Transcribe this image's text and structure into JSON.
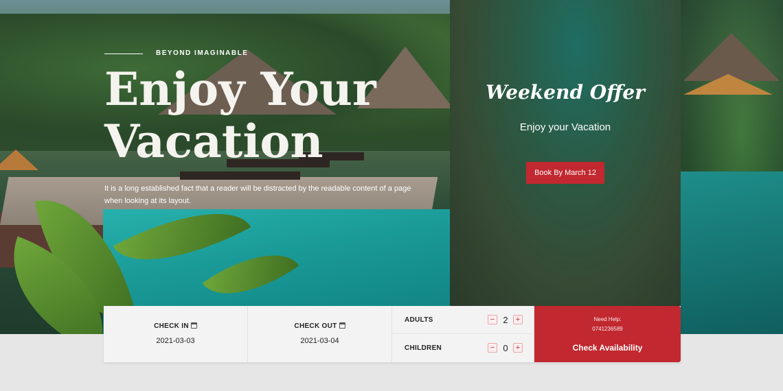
{
  "hero": {
    "eyebrow": "BEYOND IMAGINABLE",
    "title_line1": "Enjoy Your",
    "title_line2": "Vacation",
    "description": "It is a long established fact that a reader will be distracted by the readable content of a page when looking at its layout."
  },
  "offer": {
    "title": "Weekend Offer",
    "subtitle": "Enjoy your Vacation",
    "button_label": "Book By March 12"
  },
  "booking": {
    "check_in": {
      "label": "CHECK IN",
      "value": "2021-03-03",
      "icon": "calendar-icon"
    },
    "check_out": {
      "label": "CHECK OUT",
      "value": "2021-03-04",
      "icon": "calendar-icon"
    },
    "adults": {
      "label": "ADULTS",
      "value": "2",
      "minus": "−",
      "plus": "+"
    },
    "children": {
      "label": "CHILDREN",
      "value": "0",
      "minus": "−",
      "plus": "+"
    },
    "help_label": "Need Help:",
    "help_phone": "0741236589",
    "cta_label": "Check Availability"
  },
  "colors": {
    "accent": "#c1282f",
    "bar_bg": "#f3f3f3",
    "page_bg": "#e6e6e6"
  }
}
